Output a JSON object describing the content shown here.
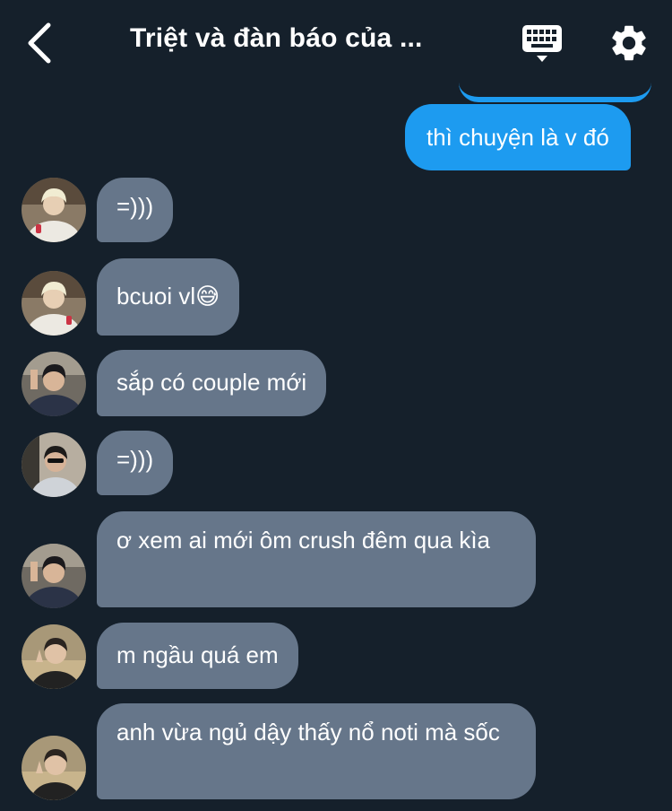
{
  "header": {
    "title": "Triệt và đàn báo của ...",
    "back_icon": "chevron-left-icon",
    "keyboard_icon": "keyboard-icon",
    "settings_icon": "gear-icon"
  },
  "colors": {
    "background": "#15202b",
    "outgoing_bubble": "#1d9bf0",
    "incoming_bubble": "#66768a"
  },
  "outgoing": [
    {
      "text": "thì chuyện là v đó"
    }
  ],
  "messages": [
    {
      "text": "=)))",
      "avatar": "avatar-blond"
    },
    {
      "text": "bcuoi vl😅",
      "avatar": "avatar-blond"
    },
    {
      "text": "sắp có couple mới",
      "avatar": "avatar-darkhair"
    },
    {
      "text": "=)))",
      "avatar": "avatar-sunglasses"
    },
    {
      "text": "ơ xem ai mới ôm crush đêm qua kìa",
      "avatar": "avatar-darkhair"
    },
    {
      "text": "m ngầu quá em",
      "avatar": "avatar-peace"
    },
    {
      "text": "anh vừa ngủ dậy thấy nổ noti mà sốc",
      "avatar": "avatar-peace"
    }
  ]
}
